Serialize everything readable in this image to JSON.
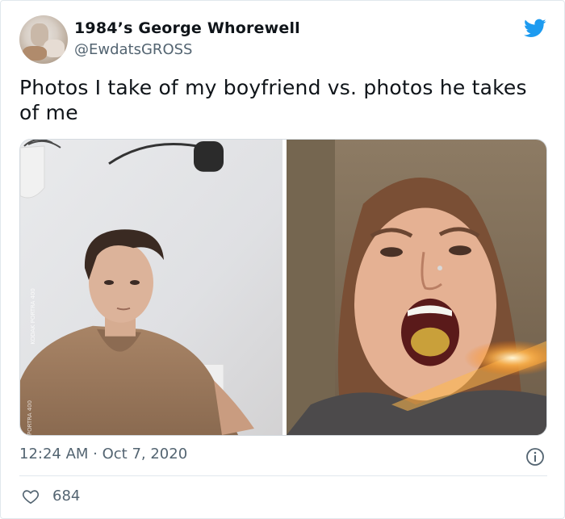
{
  "author": {
    "display_name": "1984’s George Whorewell",
    "handle": "@EwdatsGROSS"
  },
  "tweet": {
    "text": "Photos I take of my boyfriend vs. photos he takes of me",
    "timestamp": "12:24 AM · Oct 7, 2020",
    "like_count": "684"
  },
  "media": {
    "photo_left_watermark": "KODAK PORTRA 400",
    "photo_left_corner_mark": "PORTRA 400"
  },
  "icons": {
    "brand": "twitter-bird-icon",
    "info": "info-icon",
    "like": "heart-icon"
  },
  "colors": {
    "twitter_blue": "#1d9bf0",
    "secondary_text": "#536471",
    "primary_text": "#0f1419",
    "border": "#e1e8ed"
  }
}
